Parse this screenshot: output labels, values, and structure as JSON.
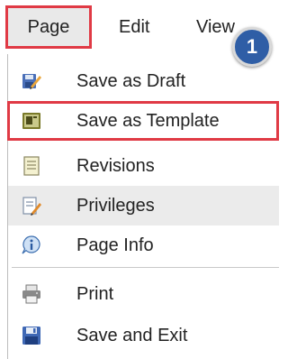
{
  "menubar": {
    "tabs": [
      {
        "label": "Page",
        "icon": null
      },
      {
        "label": "Edit"
      },
      {
        "label": "View"
      }
    ]
  },
  "badge": {
    "number": "1",
    "color": "#2f5ea6"
  },
  "dropdown": {
    "items": [
      {
        "label": "Save as Draft",
        "icon": "save-draft-icon"
      },
      {
        "label": "Save as Template",
        "icon": "save-template-icon"
      },
      {
        "label": "Revisions",
        "icon": "revisions-icon"
      },
      {
        "label": "Privileges",
        "icon": "privileges-icon"
      },
      {
        "label": "Page Info",
        "icon": "page-info-icon"
      },
      {
        "label": "Print",
        "icon": "printer-icon"
      },
      {
        "label": "Save and Exit",
        "icon": "save-exit-icon"
      }
    ]
  },
  "colors": {
    "highlight_box": "#e03a45",
    "hover_row": "#ebebeb"
  }
}
